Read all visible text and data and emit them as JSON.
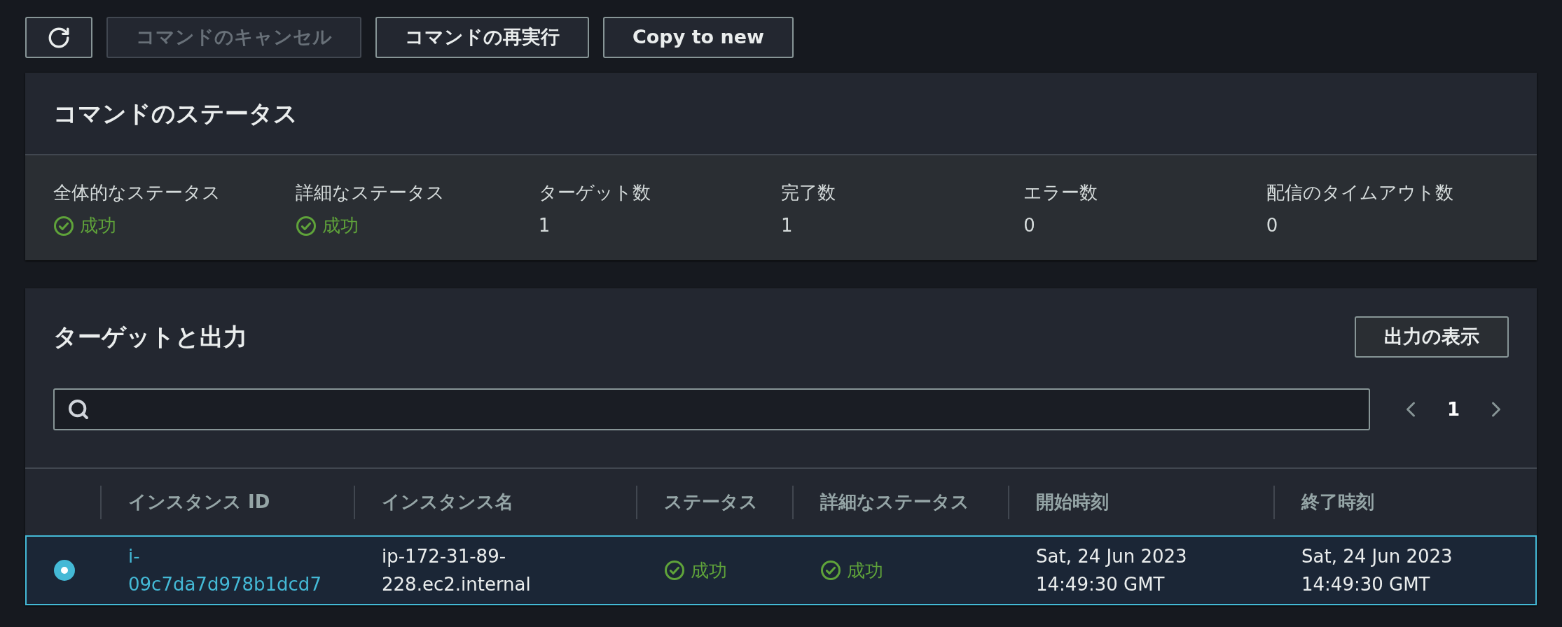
{
  "toolbar": [
    {
      "kind": "icon",
      "disabled": false
    },
    {
      "kind": "text",
      "label": "コマンドのキャンセル",
      "disabled": true
    },
    {
      "kind": "text",
      "label": "コマンドの再実行",
      "disabled": false
    },
    {
      "kind": "text",
      "label": "Copy to new",
      "disabled": false
    }
  ],
  "command_status": {
    "title": "コマンドのステータス",
    "items": [
      {
        "label": "全体的なステータス",
        "kind": "status",
        "value": "成功"
      },
      {
        "label": "詳細なステータス",
        "kind": "status",
        "value": "成功"
      },
      {
        "label": "ターゲット数",
        "kind": "count",
        "value": "1"
      },
      {
        "label": "完了数",
        "kind": "count",
        "value": "1"
      },
      {
        "label": "エラー数",
        "kind": "count",
        "value": "0"
      },
      {
        "label": "配信のタイムアウト数",
        "kind": "count",
        "value": "0"
      }
    ]
  },
  "targets": {
    "title": "ターゲットと出力",
    "show_output_button": "出力の表示",
    "pagination": {
      "page": "1"
    },
    "table": {
      "columns": [
        "インスタンス ID",
        "インスタンス名",
        "ステータス",
        "詳細なステータス",
        "開始時刻",
        "終了時刻"
      ],
      "rows": [
        {
          "selected": true,
          "instance_id": "i-09c7da7d978b1dcd7",
          "instance_name": "ip-172-31-89-228.ec2.internal",
          "status": "成功",
          "detailed_status": "成功",
          "start_time": "Sat, 24 Jun 2023 14:49:30 GMT",
          "end_time": "Sat, 24 Jun 2023 14:49:30 GMT"
        }
      ]
    }
  }
}
